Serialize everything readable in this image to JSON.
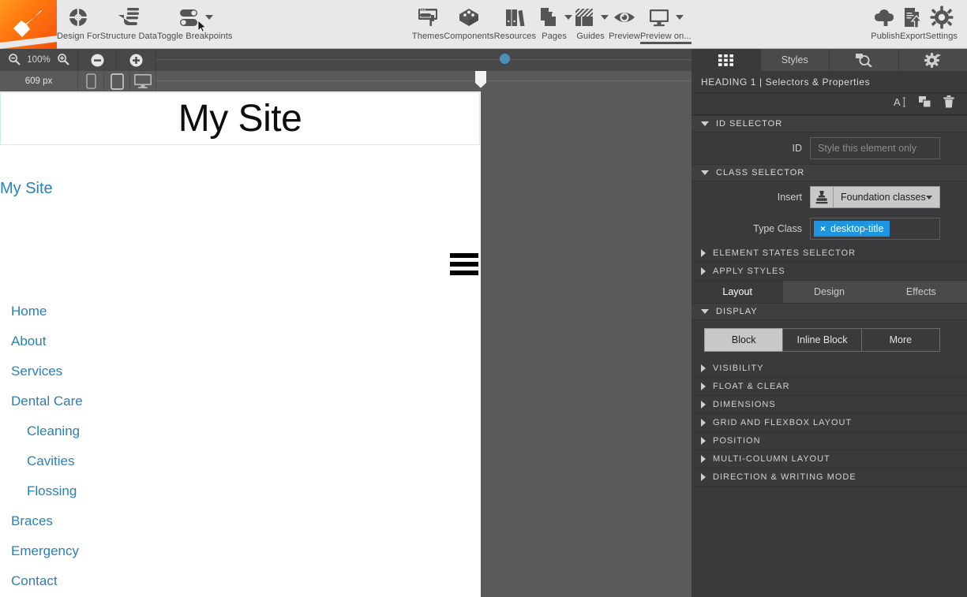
{
  "toolbar": {
    "logo": "pen-nib-logo",
    "items": [
      {
        "label": "Design For",
        "icon": "target-crosshair-icon",
        "caret": false
      },
      {
        "label": "Structure Data",
        "icon": "hand-layers-icon",
        "caret": false
      },
      {
        "label": "Toggle Breakpoints",
        "icon": "toggle-switches-icon",
        "caret": true
      },
      {
        "label": "Themes",
        "icon": "paint-roller-icon",
        "caret": false
      },
      {
        "label": "Components",
        "icon": "cube-box-icon",
        "caret": false
      },
      {
        "label": "Resources",
        "icon": "books-icon",
        "caret": false
      },
      {
        "label": "Pages",
        "icon": "pages-stack-icon",
        "caret": true
      },
      {
        "label": "Guides",
        "icon": "hatched-guides-icon",
        "caret": true
      },
      {
        "label": "Preview",
        "icon": "eye-icon",
        "caret": false
      },
      {
        "label": "Preview on...",
        "icon": "monitor-icon",
        "caret": true
      },
      {
        "label": "Publish",
        "icon": "cloud-upload-icon",
        "caret": false
      },
      {
        "label": "Export",
        "icon": "document-upload-icon",
        "caret": false
      },
      {
        "label": "Settings",
        "icon": "gear-icon",
        "caret": false
      }
    ],
    "active_item": "Preview on..."
  },
  "zoombar": {
    "zoom_out_icon": "magnifier-minus-icon",
    "zoom_level": "100%",
    "zoom_in_icon": "magnifier-plus-icon",
    "minus_icon": "circle-minus-icon",
    "plus_icon": "circle-plus-icon"
  },
  "rulerbar": {
    "width_value": "609 px",
    "devices": [
      {
        "name": "phone-icon"
      },
      {
        "name": "tablet-icon"
      },
      {
        "name": "desktop-icon"
      }
    ],
    "selected_device": "desktop-icon"
  },
  "canvas": {
    "heading": "My Site",
    "brand": "My Site",
    "menu_icon": "hamburger-menu-icon",
    "nav": [
      {
        "label": "Home",
        "level": 0
      },
      {
        "label": "About",
        "level": 0
      },
      {
        "label": "Services",
        "level": 0
      },
      {
        "label": "Dental Care",
        "level": 0
      },
      {
        "label": "Cleaning",
        "level": 1
      },
      {
        "label": "Cavities",
        "level": 1
      },
      {
        "label": "Flossing",
        "level": 1
      },
      {
        "label": "Braces",
        "level": 0
      },
      {
        "label": "Emergency",
        "level": 0
      },
      {
        "label": "Contact",
        "level": 0
      }
    ],
    "link_color": "#2780ba"
  },
  "panel": {
    "tabs": [
      {
        "label": "",
        "icon": "grid-squares-icon",
        "selected": true
      },
      {
        "label": "Styles",
        "icon": "",
        "selected": false
      },
      {
        "label": "",
        "icon": "inspect-magnifier-icon",
        "selected": false
      },
      {
        "label": "",
        "icon": "gear-settings-icon",
        "selected": false
      }
    ],
    "title": "HEADING 1 | Selectors & Properties",
    "actions": [
      {
        "name": "rename-text-icon",
        "glyph": "A"
      },
      {
        "name": "duplicate-icon",
        "glyph": ""
      },
      {
        "name": "delete-trash-icon",
        "glyph": ""
      }
    ],
    "id_selector": {
      "header": "ID SELECTOR",
      "label": "ID",
      "placeholder": "Style this element only",
      "value": "",
      "expanded": true
    },
    "class_selector": {
      "header": "CLASS SELECTOR",
      "expanded": true,
      "insert_label": "Insert",
      "insert_icon": "stamp-icon",
      "dropdown_value": "Foundation classes",
      "type_class_label": "Type Class",
      "tags": [
        {
          "label": "desktop-title",
          "remove": "×",
          "color": "#1e95e0"
        }
      ]
    },
    "element_states": {
      "header": "ELEMENT STATES SELECTOR",
      "expanded": false
    },
    "apply_styles": {
      "header": "APPLY STYLES",
      "expanded": false
    },
    "prop_tabs": [
      {
        "label": "Layout",
        "selected": true
      },
      {
        "label": "Design",
        "selected": false
      },
      {
        "label": "Effects",
        "selected": false
      }
    ],
    "display": {
      "header": "DISPLAY",
      "expanded": true,
      "options": [
        {
          "label": "Block",
          "selected": true
        },
        {
          "label": "Inline Block",
          "selected": false
        },
        {
          "label": "More",
          "selected": false
        }
      ]
    },
    "sections": [
      {
        "header": "VISIBILITY"
      },
      {
        "header": "FLOAT & CLEAR"
      },
      {
        "header": "DIMENSIONS"
      },
      {
        "header": "GRID AND FLEXBOX LAYOUT"
      },
      {
        "header": "POSITION"
      },
      {
        "header": "MULTI-COLUMN LAYOUT"
      },
      {
        "header": "DIRECTION & WRITING MODE"
      }
    ]
  }
}
